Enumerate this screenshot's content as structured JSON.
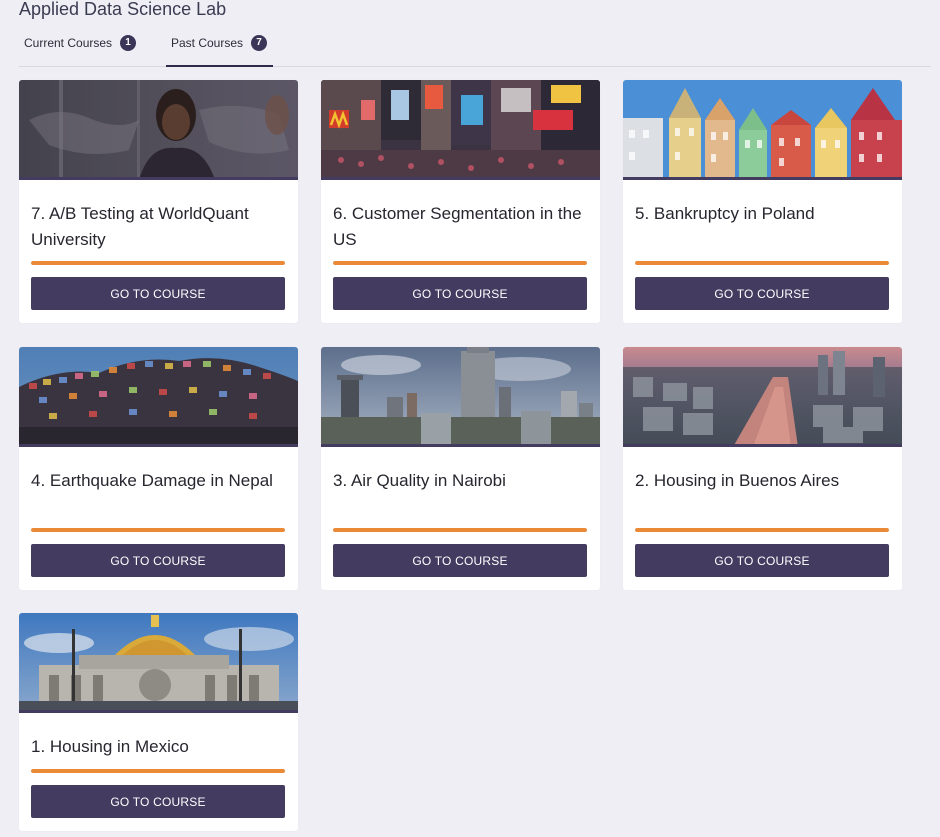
{
  "header": {
    "title": "Applied Data Science Lab"
  },
  "tabs": [
    {
      "label": "Current Courses",
      "count": "1",
      "active": false
    },
    {
      "label": "Past Courses",
      "count": "7",
      "active": true
    }
  ],
  "colors": {
    "accent": "#ea8a37",
    "button": "#433b60",
    "background": "#efeef4"
  },
  "courses": [
    {
      "title": "7. A/B Testing at WorldQuant University",
      "button": "GO TO COURSE",
      "progress": 1.0,
      "image": "person-with-world-map-icon"
    },
    {
      "title": "6. Customer Segmentation in the US",
      "button": "GO TO COURSE",
      "progress": 1.0,
      "image": "times-square-icon"
    },
    {
      "title": "5. Bankruptcy in Poland",
      "button": "GO TO COURSE",
      "progress": 1.0,
      "image": "colorful-houses-icon"
    },
    {
      "title": "4. Earthquake Damage in Nepal",
      "button": "GO TO COURSE",
      "progress": 1.0,
      "image": "hillside-village-icon"
    },
    {
      "title": "3. Air Quality in Nairobi",
      "button": "GO TO COURSE",
      "progress": 1.0,
      "image": "city-skyline-icon"
    },
    {
      "title": "2. Housing in Buenos Aires",
      "button": "GO TO COURSE",
      "progress": 1.0,
      "image": "city-river-aerial-icon"
    },
    {
      "title": "1. Housing in Mexico",
      "button": "GO TO COURSE",
      "progress": 1.0,
      "image": "palace-dome-icon"
    }
  ]
}
